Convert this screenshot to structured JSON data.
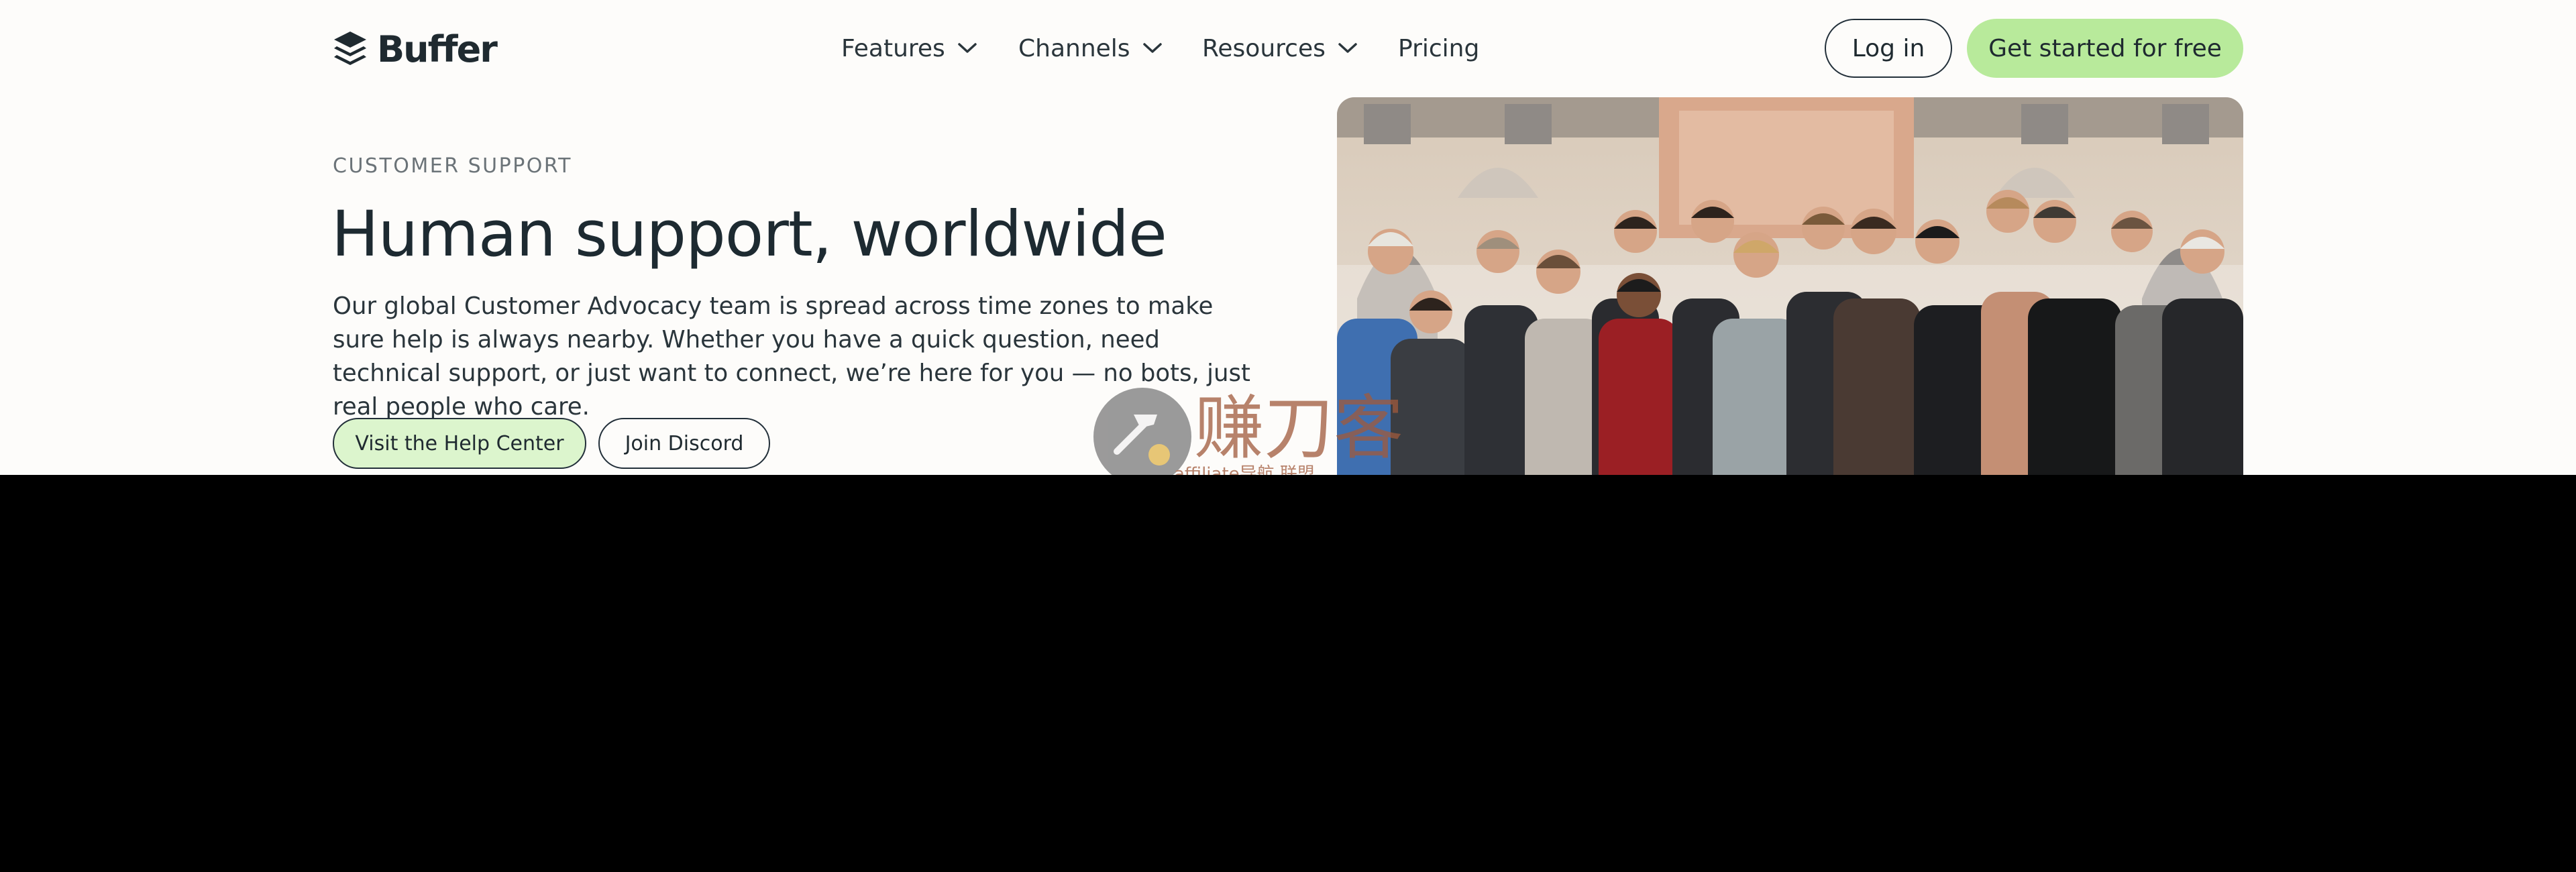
{
  "brand": {
    "name": "Buffer",
    "icon": "buffer-stack-icon"
  },
  "nav": {
    "items": [
      {
        "label": "Features",
        "icon": "chevron-down-icon"
      },
      {
        "label": "Channels",
        "icon": "chevron-down-icon"
      },
      {
        "label": "Resources",
        "icon": "chevron-down-icon"
      },
      {
        "label": "Pricing"
      }
    ],
    "login_label": "Log in",
    "cta_label": "Get started for free"
  },
  "hero": {
    "eyebrow": "CUSTOMER SUPPORT",
    "title": "Human support, worldwide",
    "description": "Our global Customer Advocacy team is spread across time zones to make sure help is always nearby. Whether you have a quick question, need technical support, or just want to connect, we’re here for you — no bots, just real people who care.",
    "primary_button": "Visit the Help Center",
    "secondary_button": "Join Discord"
  },
  "watermark": {
    "text": "赚刀客",
    "subtext": "affiliate导航 联盟"
  },
  "colors": {
    "page_bg": "#fdfcfa",
    "cta_green": "#b8ea9b",
    "help_button_green": "#dcf5cd",
    "text_dark": "#1d2a31",
    "text_muted": "#6b7378",
    "below_fold": "#000000"
  }
}
